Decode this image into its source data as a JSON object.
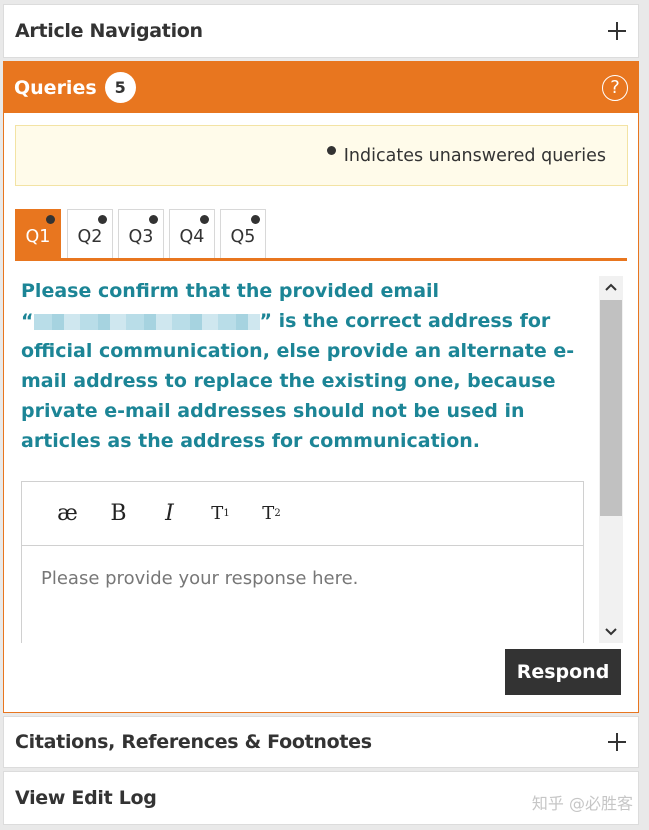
{
  "article_nav": {
    "title": "Article Navigation"
  },
  "queries": {
    "title": "Queries",
    "count": "5",
    "help_icon": "?",
    "notice": "Indicates unanswered queries",
    "tabs": [
      {
        "label": "Q1",
        "active": true,
        "unanswered": true
      },
      {
        "label": "Q2",
        "active": false,
        "unanswered": true
      },
      {
        "label": "Q3",
        "active": false,
        "unanswered": true
      },
      {
        "label": "Q4",
        "active": false,
        "unanswered": true
      },
      {
        "label": "Q5",
        "active": false,
        "unanswered": true
      }
    ],
    "question": {
      "part1": "Please confirm that the provided email",
      "quote_open": "“",
      "part2": "” is the correct address for official communication, else provide an alternate e-mail address to replace the existing one, because private e-mail addresses should not be used in articles as the address for communication."
    },
    "editor": {
      "toolbar": [
        {
          "name": "ae-ligature-button",
          "label": "æ"
        },
        {
          "name": "bold-button",
          "label": "B"
        },
        {
          "name": "italic-button",
          "label": "I"
        },
        {
          "name": "superscript-button",
          "label": "T",
          "mark": "1"
        },
        {
          "name": "subscript-button",
          "label": "T",
          "mark": "2"
        }
      ],
      "placeholder": "Please provide your response here."
    },
    "respond_label": "Respond"
  },
  "citations": {
    "title": "Citations, References & Footnotes"
  },
  "edit_log": {
    "title": "View Edit Log"
  },
  "watermark": "知乎 @必胜客",
  "colors": {
    "accent": "#e8761f",
    "query_text": "#1c8596",
    "notice_bg": "#fffbea"
  }
}
